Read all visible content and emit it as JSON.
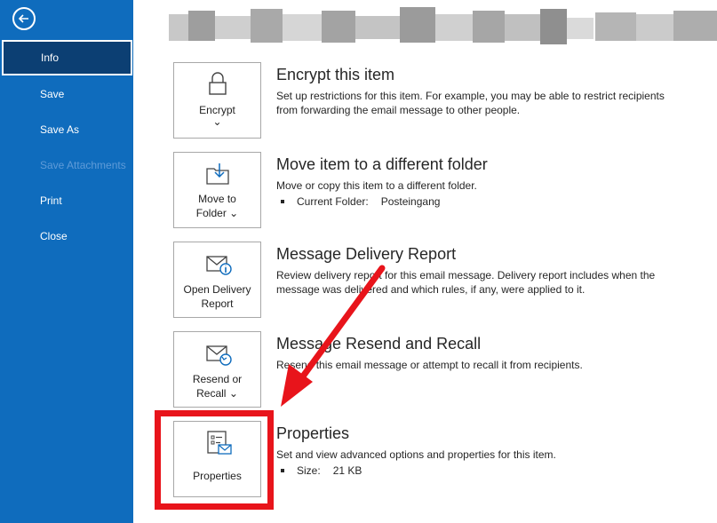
{
  "sidebar": {
    "items": [
      {
        "label": "Info",
        "state": "active"
      },
      {
        "label": "Save"
      },
      {
        "label": "Save As"
      },
      {
        "label": "Save Attachments",
        "state": "disabled"
      },
      {
        "label": "Print"
      },
      {
        "label": "Close"
      }
    ]
  },
  "sections": {
    "encrypt": {
      "button_label": "Encrypt",
      "title": "Encrypt this item",
      "desc_line1": "Set up restrictions for this item. For example, you may be able to restrict recipients",
      "desc_line2": "from forwarding the email message to other people."
    },
    "move": {
      "button_line1": "Move to",
      "button_line2": "Folder",
      "title": "Move item to a different folder",
      "desc": "Move or copy this item to a different folder.",
      "bullet_label": "Current Folder:",
      "bullet_value": "Posteingang"
    },
    "delivery": {
      "button_line1": "Open Delivery",
      "button_line2": "Report",
      "title": "Message Delivery Report",
      "desc_line1": "Review delivery report for this email message. Delivery report includes when the",
      "desc_line2": "message was delivered and which rules, if any, were applied to it."
    },
    "resend": {
      "button_line1": "Resend or",
      "button_line2": "Recall",
      "title": "Message Resend and Recall",
      "desc": "Resend this email message or attempt to recall it from recipients."
    },
    "properties": {
      "button_label": "Properties",
      "title": "Properties",
      "desc": "Set and view advanced options and properties for this item.",
      "bullet_label": "Size:",
      "bullet_value": "21 KB"
    }
  },
  "colors": {
    "sidebar_bg": "#0f6cbd",
    "sidebar_active_bg": "#0c3f73",
    "annotation_red": "#e8141b"
  },
  "icons": [
    "back-arrow-icon",
    "lock-icon",
    "folder-move-icon",
    "envelope-info-icon",
    "envelope-resend-icon",
    "properties-icon",
    "chevron-down-icon"
  ]
}
